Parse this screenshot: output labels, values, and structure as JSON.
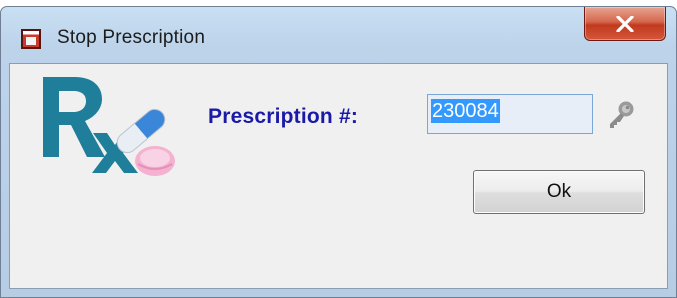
{
  "window": {
    "title": "Stop Prescription",
    "close_label": "X"
  },
  "form": {
    "prescription_label": "Prescription #:",
    "prescription_value": "230084"
  },
  "buttons": {
    "ok_label": "Ok"
  },
  "icons": {
    "app": "app-window-icon",
    "logo": "rx-pills-logo",
    "lookup": "key-icon",
    "close": "close-icon"
  },
  "colors": {
    "label_text": "#1a1aa6",
    "selection": "#3399ff",
    "close_button": "#c1391d",
    "logo_rx": "#1f7f9a"
  }
}
